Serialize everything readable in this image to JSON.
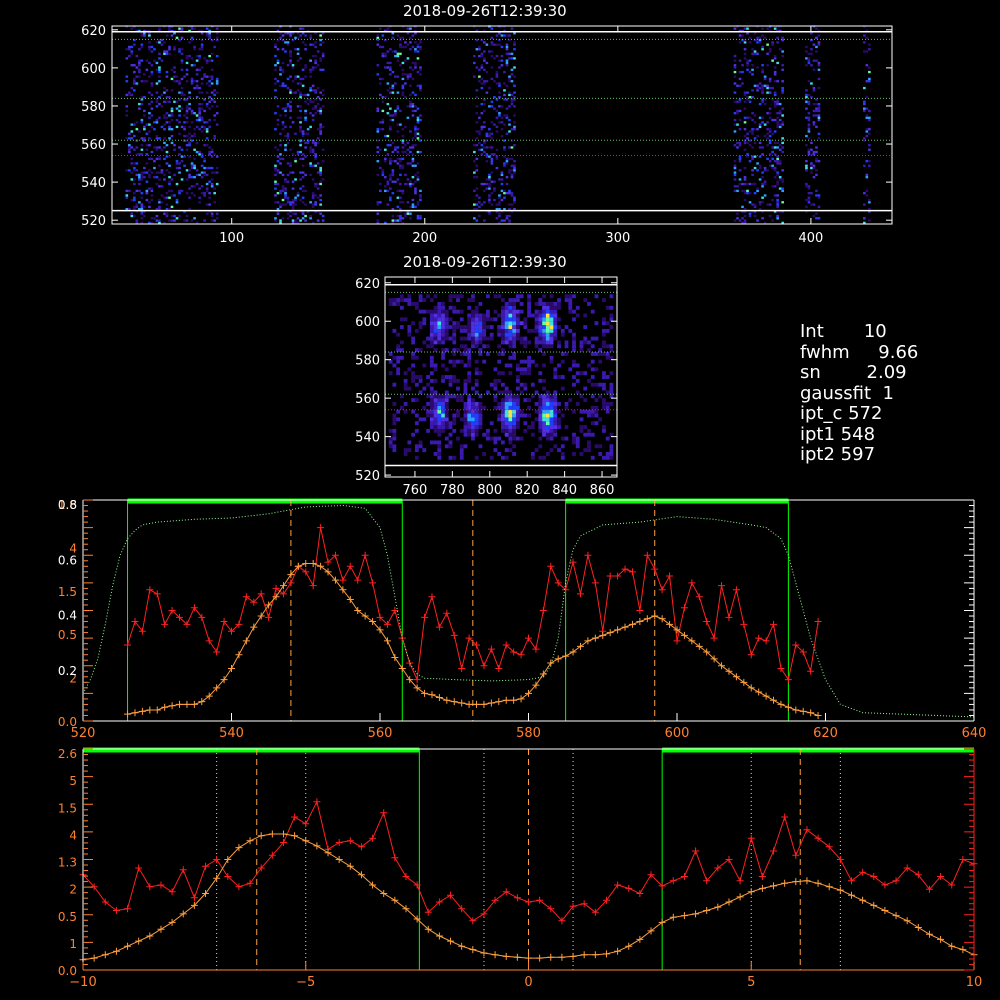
{
  "colors": {
    "background": "#000000",
    "frame": "#ffffff",
    "bright_trace": "#ff2020",
    "fit_trace": "#ffa040",
    "range_bar": "#00ff00",
    "dotted_profile": "#90ff90",
    "dashed_marker": "#ffa040",
    "axis_orange": "#ff8030"
  },
  "spectrum_panel": {
    "title": "2018-09-26T12:39:30",
    "x_ticks": [
      "100",
      "200",
      "300",
      "400"
    ],
    "y_ticks": [
      "620",
      "600",
      "580",
      "560",
      "540",
      "520"
    ],
    "xlim": [
      38,
      442
    ],
    "ylim": [
      518,
      622
    ],
    "data_columns": [
      [
        45,
        92
      ],
      [
        122,
        147
      ],
      [
        175,
        198
      ],
      [
        225,
        246
      ],
      [
        360,
        385
      ],
      [
        397,
        404
      ],
      [
        427,
        430
      ]
    ],
    "dotted_rows": [
      615,
      584,
      562
    ],
    "red_row": 554,
    "white_rows": [
      619,
      525
    ]
  },
  "zoom_panel": {
    "title": "2018-09-26T12:39:30",
    "x_ticks": [
      "760",
      "780",
      "800",
      "820",
      "840",
      "860"
    ],
    "y_ticks": [
      "620",
      "600",
      "580",
      "560",
      "540",
      "520"
    ],
    "xlim": [
      744,
      868
    ],
    "ylim": [
      519,
      623
    ],
    "blobs": [
      [
        772,
        597,
        0.6
      ],
      [
        792,
        595,
        0.5
      ],
      [
        810,
        598,
        0.8
      ],
      [
        830,
        597,
        1.0
      ],
      [
        772,
        551,
        0.6
      ],
      [
        790,
        549,
        0.5
      ],
      [
        810,
        551,
        0.9
      ],
      [
        830,
        550,
        1.0
      ]
    ]
  },
  "stats": {
    "lines": [
      "Int       10",
      "fwhm     9.66",
      "sn        2.09",
      "gaussfit  1",
      "ipt_c 572",
      "ipt1 548",
      "ipt2 597"
    ]
  },
  "chart_data": [
    {
      "type": "line",
      "x_ticks": [
        "520",
        "540",
        "560",
        "580",
        "600",
        "620",
        "640"
      ],
      "xlim": [
        520,
        640
      ],
      "ylim_left": [
        0,
        1.6
      ],
      "left_tick_labels_white": [
        "0.8",
        "0.6",
        "0.4",
        "0.2"
      ],
      "left_tick_labels_orange": [
        "1.6",
        "4",
        "1.5",
        "0.5",
        "2",
        "0.0"
      ],
      "markers": [
        548,
        572.5,
        597
      ],
      "range_bars": [
        [
          526,
          563
        ],
        [
          585,
          615
        ]
      ],
      "series": [
        {
          "x": [
            526,
            527,
            528,
            529,
            530,
            531,
            532,
            533,
            534,
            535,
            536,
            537,
            538,
            539,
            540,
            541,
            542,
            543,
            544,
            545,
            546,
            547,
            548,
            549,
            550,
            551,
            552,
            553,
            554,
            555,
            556,
            557,
            558,
            559,
            560,
            561,
            562,
            563,
            564,
            565,
            566,
            567,
            568,
            569,
            570,
            571,
            572,
            573,
            574,
            575,
            576,
            577,
            578,
            579,
            580,
            581,
            582,
            583,
            584,
            585,
            586,
            587,
            588,
            589,
            590,
            591,
            592,
            593,
            594,
            595,
            596,
            597,
            598,
            599,
            600,
            601,
            602,
            603,
            604,
            605,
            606,
            607,
            608,
            609,
            610,
            611,
            612,
            613,
            614,
            615,
            616,
            617,
            618,
            619
          ],
          "y": [
            0.55,
            0.72,
            0.65,
            0.95,
            0.92,
            0.7,
            0.8,
            0.75,
            0.7,
            0.82,
            0.75,
            0.58,
            0.5,
            0.72,
            0.65,
            0.7,
            0.9,
            0.86,
            0.92,
            0.75,
            0.96,
            0.92,
            1.0,
            1.12,
            1.08,
            0.98,
            1.4,
            1.15,
            1.2,
            1.02,
            1.12,
            1.02,
            1.2,
            1.0,
            0.75,
            0.7,
            0.8,
            0.6,
            0.42,
            0.3,
            0.75,
            0.9,
            0.68,
            0.78,
            0.62,
            0.38,
            0.6,
            0.55,
            0.4,
            0.52,
            0.38,
            0.55,
            0.5,
            0.48,
            0.6,
            0.52,
            0.8,
            1.12,
            1.0,
            0.95,
            1.15,
            0.92,
            1.2,
            1.0,
            0.65,
            1.05,
            1.05,
            1.1,
            1.08,
            0.8,
            1.2,
            1.1,
            0.95,
            1.05,
            0.58,
            0.82,
            1.0,
            0.9,
            0.72,
            0.6,
            0.98,
            0.75,
            0.95,
            0.7,
            0.48,
            0.6,
            0.58,
            0.7,
            0.38,
            0.3,
            0.55,
            0.5,
            0.36,
            0.72
          ]
        },
        {
          "x": [
            526,
            527,
            528,
            529,
            530,
            531,
            532,
            533,
            534,
            535,
            536,
            537,
            538,
            539,
            540,
            541,
            542,
            543,
            544,
            545,
            546,
            547,
            548,
            549,
            550,
            551,
            552,
            553,
            554,
            555,
            556,
            557,
            558,
            559,
            560,
            561,
            562,
            563,
            564,
            565,
            566,
            567,
            568,
            569,
            570,
            571,
            572,
            573,
            574,
            575,
            576,
            577,
            578,
            579,
            580,
            581,
            582,
            583,
            584,
            585,
            586,
            587,
            588,
            589,
            590,
            591,
            592,
            593,
            594,
            595,
            596,
            597,
            598,
            599,
            600,
            601,
            602,
            603,
            604,
            605,
            606,
            607,
            608,
            609,
            610,
            611,
            612,
            613,
            614,
            615,
            616,
            617,
            618,
            619
          ],
          "y": [
            0.05,
            0.06,
            0.07,
            0.08,
            0.08,
            0.1,
            0.11,
            0.12,
            0.12,
            0.12,
            0.14,
            0.18,
            0.24,
            0.3,
            0.38,
            0.48,
            0.58,
            0.68,
            0.76,
            0.84,
            0.9,
            0.98,
            1.06,
            1.12,
            1.14,
            1.14,
            1.12,
            1.08,
            1.02,
            0.95,
            0.88,
            0.8,
            0.76,
            0.72,
            0.66,
            0.58,
            0.46,
            0.38,
            0.3,
            0.24,
            0.2,
            0.19,
            0.17,
            0.15,
            0.14,
            0.13,
            0.12,
            0.12,
            0.12,
            0.13,
            0.14,
            0.15,
            0.15,
            0.16,
            0.2,
            0.26,
            0.34,
            0.42,
            0.45,
            0.47,
            0.5,
            0.54,
            0.58,
            0.6,
            0.62,
            0.64,
            0.66,
            0.68,
            0.7,
            0.72,
            0.74,
            0.76,
            0.74,
            0.7,
            0.66,
            0.62,
            0.58,
            0.54,
            0.5,
            0.45,
            0.4,
            0.36,
            0.32,
            0.28,
            0.24,
            0.21,
            0.18,
            0.15,
            0.12,
            0.1,
            0.08,
            0.07,
            0.06,
            0.04
          ]
        },
        {
          "x": [
            520,
            521,
            522,
            523,
            524,
            525,
            526,
            527,
            528,
            530,
            535,
            540,
            545,
            550,
            555,
            558,
            560,
            561,
            562,
            563,
            564,
            565,
            566,
            570,
            575,
            580,
            582,
            583,
            584,
            585,
            586,
            587,
            590,
            595,
            600,
            605,
            610,
            612,
            614,
            615,
            616,
            617,
            618,
            620,
            622,
            625,
            630,
            635,
            640
          ],
          "y": [
            0.2,
            0.3,
            0.45,
            0.7,
            0.98,
            1.2,
            1.32,
            1.38,
            1.42,
            1.44,
            1.46,
            1.47,
            1.5,
            1.55,
            1.56,
            1.54,
            1.4,
            1.2,
            0.9,
            0.6,
            0.42,
            0.34,
            0.31,
            0.3,
            0.29,
            0.3,
            0.32,
            0.4,
            0.6,
            1.0,
            1.24,
            1.34,
            1.42,
            1.44,
            1.48,
            1.46,
            1.42,
            1.4,
            1.32,
            1.2,
            1.0,
            0.8,
            0.6,
            0.3,
            0.12,
            0.06,
            0.05,
            0.04,
            0.03
          ]
        }
      ]
    },
    {
      "type": "line",
      "x_ticks": [
        "−10",
        "−5",
        "0",
        "5",
        "10"
      ],
      "xlim": [
        -10,
        10
      ],
      "ylim_left": [
        0,
        2.6
      ],
      "left_tick_labels_orange": [
        "2.6",
        "5",
        "1.5",
        "4",
        "1.3",
        "2",
        "0.5",
        "1",
        "0.0"
      ],
      "markers": [
        -6.1,
        0,
        6.1
      ],
      "dotted_markers": [
        -7,
        -5,
        -1,
        1,
        5,
        7
      ],
      "range_bars": [
        [
          -10,
          -2.45
        ],
        [
          3.0,
          10
        ]
      ],
      "series": [
        {
          "x": [
            -10,
            -9.75,
            -9.5,
            -9.25,
            -9.0,
            -8.75,
            -8.5,
            -8.25,
            -8.0,
            -7.75,
            -7.5,
            -7.25,
            -7.0,
            -6.75,
            -6.5,
            -6.25,
            -6.0,
            -5.75,
            -5.5,
            -5.25,
            -5.0,
            -4.75,
            -4.5,
            -4.25,
            -4.0,
            -3.75,
            -3.5,
            -3.25,
            -3.0,
            -2.75,
            -2.5,
            -2.25,
            -2.0,
            -1.75,
            -1.5,
            -1.25,
            -1.0,
            -0.75,
            -0.5,
            -0.25,
            0,
            0.25,
            0.5,
            0.75,
            1.0,
            1.25,
            1.5,
            1.75,
            2.0,
            2.25,
            2.5,
            2.75,
            3.0,
            3.25,
            3.5,
            3.75,
            4.0,
            4.25,
            4.5,
            4.75,
            5.0,
            5.25,
            5.5,
            5.75,
            6.0,
            6.25,
            6.5,
            6.75,
            7.0,
            7.25,
            7.5,
            7.75,
            8.0,
            8.25,
            8.5,
            8.75,
            9.0,
            9.25,
            9.5,
            9.75,
            10
          ],
          "y": [
            1.12,
            0.98,
            0.8,
            0.7,
            0.72,
            1.2,
            0.98,
            1.0,
            0.92,
            1.18,
            0.85,
            1.22,
            1.3,
            1.1,
            0.98,
            1.02,
            1.2,
            1.35,
            1.5,
            1.8,
            1.72,
            1.98,
            1.42,
            1.5,
            1.52,
            1.45,
            1.55,
            1.85,
            1.32,
            1.1,
            1.0,
            0.68,
            0.8,
            0.88,
            0.72,
            0.58,
            0.66,
            0.82,
            0.92,
            0.85,
            0.8,
            0.82,
            0.72,
            0.58,
            0.75,
            0.78,
            0.68,
            0.82,
            1.0,
            0.96,
            0.9,
            1.12,
            0.99,
            1.05,
            1.1,
            1.4,
            1.05,
            1.2,
            1.3,
            1.05,
            1.55,
            1.1,
            1.4,
            1.8,
            1.35,
            1.65,
            1.55,
            1.45,
            1.3,
            1.05,
            1.15,
            1.1,
            1.0,
            1.05,
            1.2,
            1.12,
            0.95,
            1.1,
            1.0,
            1.3,
            1.25
          ]
        },
        {
          "x": [
            -10,
            -9.75,
            -9.5,
            -9.25,
            -9.0,
            -8.75,
            -8.5,
            -8.25,
            -8.0,
            -7.75,
            -7.5,
            -7.25,
            -7.0,
            -6.75,
            -6.5,
            -6.25,
            -6.0,
            -5.75,
            -5.5,
            -5.25,
            -5.0,
            -4.75,
            -4.5,
            -4.25,
            -4.0,
            -3.75,
            -3.5,
            -3.25,
            -3.0,
            -2.75,
            -2.5,
            -2.25,
            -2.0,
            -1.75,
            -1.5,
            -1.25,
            -1.0,
            -0.75,
            -0.5,
            -0.25,
            0,
            0.25,
            0.5,
            0.75,
            1.0,
            1.25,
            1.5,
            1.75,
            2.0,
            2.25,
            2.5,
            2.75,
            3.0,
            3.25,
            3.5,
            3.75,
            4.0,
            4.25,
            4.5,
            4.75,
            5.0,
            5.25,
            5.5,
            5.75,
            6.0,
            6.25,
            6.5,
            6.75,
            7.0,
            7.25,
            7.5,
            7.75,
            8.0,
            8.25,
            8.5,
            8.75,
            9.0,
            9.25,
            9.5,
            9.75,
            10
          ],
          "y": [
            0.12,
            0.14,
            0.18,
            0.22,
            0.28,
            0.34,
            0.4,
            0.48,
            0.56,
            0.66,
            0.76,
            0.9,
            1.08,
            1.3,
            1.44,
            1.52,
            1.58,
            1.6,
            1.6,
            1.58,
            1.52,
            1.46,
            1.38,
            1.3,
            1.22,
            1.12,
            1.0,
            0.9,
            0.82,
            0.72,
            0.6,
            0.48,
            0.4,
            0.34,
            0.28,
            0.24,
            0.2,
            0.18,
            0.16,
            0.15,
            0.14,
            0.14,
            0.15,
            0.15,
            0.16,
            0.18,
            0.18,
            0.19,
            0.22,
            0.28,
            0.36,
            0.46,
            0.56,
            0.62,
            0.64,
            0.66,
            0.7,
            0.74,
            0.8,
            0.86,
            0.92,
            0.96,
            0.99,
            1.02,
            1.04,
            1.05,
            1.02,
            0.98,
            0.94,
            0.88,
            0.82,
            0.76,
            0.7,
            0.64,
            0.58,
            0.5,
            0.42,
            0.36,
            0.28,
            0.24,
            0.18
          ]
        }
      ]
    }
  ]
}
